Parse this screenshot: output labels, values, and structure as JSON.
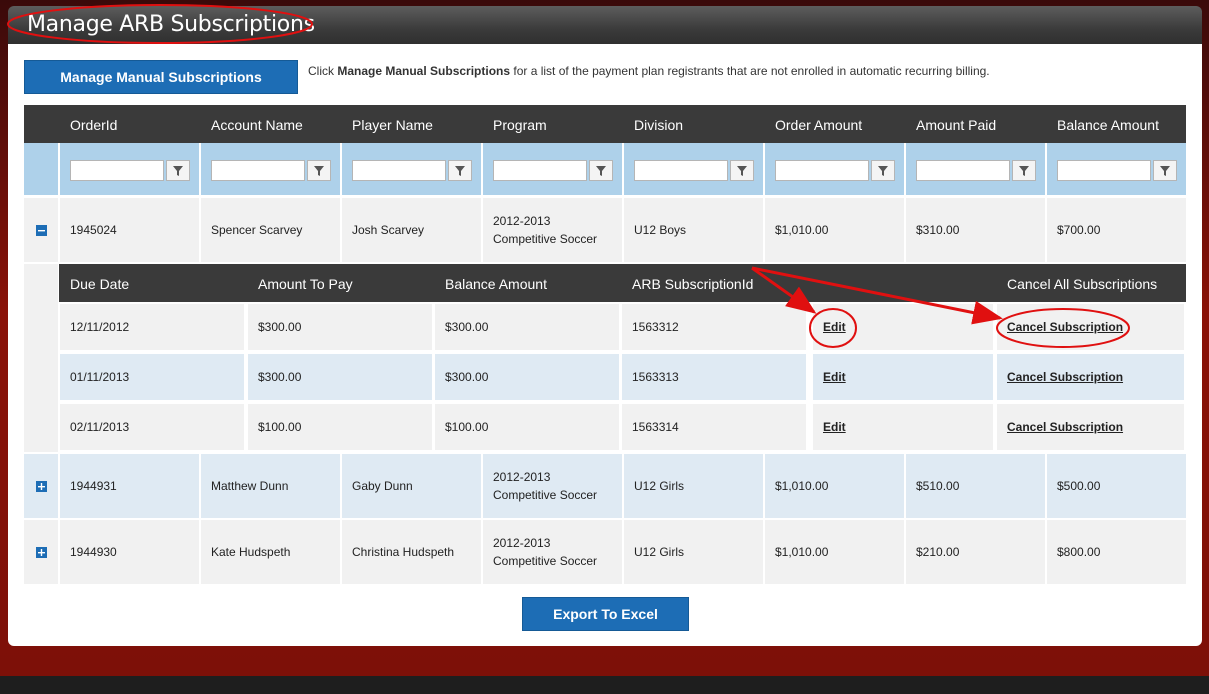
{
  "page": {
    "title": "Manage ARB Subscriptions"
  },
  "toolbar": {
    "manual_button_label": "Manage Manual Subscriptions",
    "info_prefix": "Click ",
    "info_bold": "Manage Manual Subscriptions",
    "info_suffix": " for a list of the payment plan registrants that are not enrolled in automatic recurring billing."
  },
  "grid": {
    "columns": [
      "OrderId",
      "Account Name",
      "Player Name",
      "Program",
      "Division",
      "Order Amount",
      "Amount Paid",
      "Balance Amount"
    ],
    "filter_icon": "filter-icon",
    "rows": [
      {
        "expanded": true,
        "toggle_icon": "collapse-minus-icon",
        "order_id": "1945024",
        "account_name": "Spencer Scarvey",
        "player_name": "Josh Scarvey",
        "program_line1": "2012-2013",
        "program_line2": "Competitive Soccer",
        "division": "U12 Boys",
        "order_amount": "$1,010.00",
        "amount_paid": "$310.00",
        "balance_amount": "$700.00"
      },
      {
        "expanded": false,
        "toggle_icon": "expand-plus-icon",
        "order_id": "1944931",
        "account_name": "Matthew Dunn",
        "player_name": "Gaby Dunn",
        "program_line1": "2012-2013",
        "program_line2": "Competitive Soccer",
        "division": "U12 Girls",
        "order_amount": "$1,010.00",
        "amount_paid": "$510.00",
        "balance_amount": "$500.00"
      },
      {
        "expanded": false,
        "toggle_icon": "expand-plus-icon",
        "order_id": "1944930",
        "account_name": "Kate Hudspeth",
        "player_name": "Christina Hudspeth",
        "program_line1": "2012-2013",
        "program_line2": "Competitive Soccer",
        "division": "U12 Girls",
        "order_amount": "$1,010.00",
        "amount_paid": "$210.00",
        "balance_amount": "$800.00"
      }
    ]
  },
  "detail": {
    "columns": [
      "Due Date",
      "Amount To Pay",
      "Balance Amount",
      "ARB SubscriptionId",
      "",
      "Cancel All Subscriptions"
    ],
    "rows": [
      {
        "due_date": "12/11/2012",
        "amount_to_pay": "$300.00",
        "balance_amount": "$300.00",
        "subscription_id": "1563312",
        "edit_label": "Edit",
        "cancel_label": "Cancel Subscription"
      },
      {
        "due_date": "01/11/2013",
        "amount_to_pay": "$300.00",
        "balance_amount": "$300.00",
        "subscription_id": "1563313",
        "edit_label": "Edit",
        "cancel_label": "Cancel Subscription"
      },
      {
        "due_date": "02/11/2013",
        "amount_to_pay": "$100.00",
        "balance_amount": "$100.00",
        "subscription_id": "1563314",
        "edit_label": "Edit",
        "cancel_label": "Cancel Subscription"
      }
    ]
  },
  "footer": {
    "export_label": "Export To Excel"
  },
  "colors": {
    "button_blue": "#1d6db5",
    "header_dark": "#3a3a3a",
    "filter_row": "#aed1ea",
    "row_gray": "#f1f1f1",
    "row_blue": "#dfeaf3",
    "annotation_red": "#e01010"
  }
}
